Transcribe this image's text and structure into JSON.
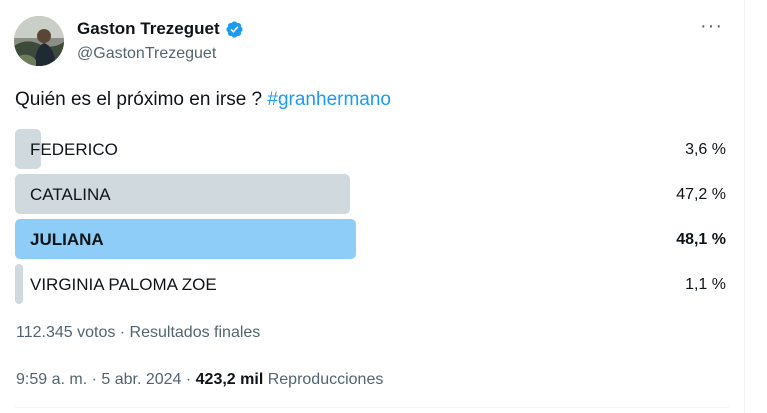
{
  "author": {
    "display_name": "Gaston Trezeguet",
    "handle": "@GastonTrezeguet",
    "verified_icon": "verified-badge-icon",
    "more_label": "···"
  },
  "tweet": {
    "text": "Quién es el próximo en irse ? ",
    "hashtag": "#granhermano"
  },
  "poll": {
    "options": [
      {
        "label": "FEDERICO",
        "percent_text": "3,6 %",
        "percent": 3.6
      },
      {
        "label": "CATALINA",
        "percent_text": "47,2 %",
        "percent": 47.2
      },
      {
        "label": "JULIANA",
        "percent_text": "48,1 %",
        "percent": 48.1
      },
      {
        "label": "VIRGINIA PALOMA ZOE",
        "percent_text": "1,1 %",
        "percent": 1.1
      }
    ],
    "winner_index": 2,
    "meta": "112.345 votos · Resultados finales"
  },
  "footer": {
    "time": "9:59 a. m. · 5 abr. 2024 · ",
    "views_count": "423,2 mil",
    "views_label": " Reproducciones"
  },
  "colors": {
    "accent": "#1d9bf0",
    "bar_default": "#cfd9de",
    "bar_winner": "#8ecdf8"
  }
}
